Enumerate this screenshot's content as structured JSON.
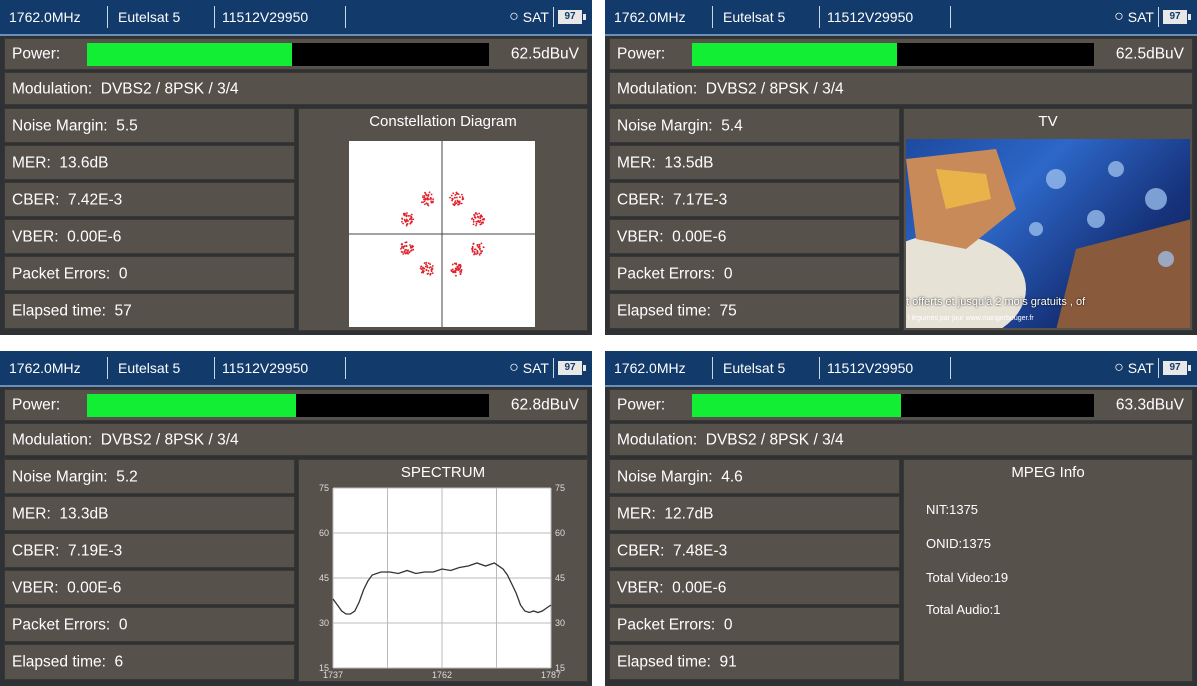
{
  "header": {
    "frequency": "1762.0MHz",
    "satellite": "Eutelsat 5",
    "transponder": "11512V29950",
    "mode": "SAT",
    "battery": "97",
    "dish_icon": "satellite-dish-icon"
  },
  "labels": {
    "power": "Power:",
    "modulation": "Modulation:",
    "noise_margin": "Noise Margin:",
    "mer": "MER:",
    "cber": "CBER:",
    "vber": "VBER:",
    "packet_errors": "Packet Errors:",
    "elapsed_time": "Elapsed time:"
  },
  "colors": {
    "header_bg": "#123a6a",
    "power_fill": "#11ee33",
    "constellation_points": "#e0202a",
    "spectrum_line": "#333333"
  },
  "screens": [
    {
      "power": "62.5dBuV",
      "power_level": 0.51,
      "modulation": "DVBS2 / 8PSK / 3/4",
      "noise_margin": "5.5",
      "mer": "13.6dB",
      "cber": "7.42E-3",
      "vber": "0.00E-6",
      "packet_errors": "0",
      "elapsed_time": "57",
      "panel_title": "Constellation Diagram",
      "panel_type": "constellation"
    },
    {
      "power": "62.5dBuV",
      "power_level": 0.51,
      "modulation": "DVBS2 / 8PSK / 3/4",
      "noise_margin": "5.4",
      "mer": "13.5dB",
      "cber": "7.17E-3",
      "vber": "0.00E-6",
      "packet_errors": "0",
      "elapsed_time": "75",
      "panel_title": "TV",
      "panel_type": "tv",
      "tv_caption": "t offerts et jusqu'à 2 mois gratuits , of",
      "tv_subcaption": "l légumes par jour www.mangerbouger.fr"
    },
    {
      "power": "62.8dBuV",
      "power_level": 0.52,
      "modulation": "DVBS2 / 8PSK / 3/4",
      "noise_margin": "5.2",
      "mer": "13.3dB",
      "cber": "7.19E-3",
      "vber": "0.00E-6",
      "packet_errors": "0",
      "elapsed_time": "6",
      "panel_title": "SPECTRUM",
      "panel_type": "spectrum"
    },
    {
      "power": "63.3dBuV",
      "power_level": 0.52,
      "modulation": "DVBS2 / 8PSK / 3/4",
      "noise_margin": "4.6",
      "mer": "12.7dB",
      "cber": "7.48E-3",
      "vber": "0.00E-6",
      "packet_errors": "0",
      "elapsed_time": "91",
      "panel_title": "MPEG Info",
      "panel_type": "mpeg",
      "mpeg": {
        "nit": "NIT:1375",
        "onid": "ONID:1375",
        "total_video": "Total Video:19",
        "total_audio": "Total Audio:1"
      }
    }
  ],
  "chart_data": {
    "type": "line",
    "title": "SPECTRUM",
    "x_ticks": [
      "1737",
      "1762",
      "1787"
    ],
    "xlim": [
      1737,
      1787
    ],
    "y_ticks_left": [
      "75",
      "60",
      "45",
      "30",
      "15"
    ],
    "y_ticks_right": [
      "75",
      "60",
      "45",
      "30",
      "15"
    ],
    "ylim": [
      15,
      75
    ],
    "grid": true,
    "x": [
      1737,
      1738,
      1739,
      1740,
      1741,
      1742,
      1743,
      1744,
      1745,
      1746,
      1748,
      1750,
      1752,
      1754,
      1756,
      1758,
      1760,
      1762,
      1764,
      1766,
      1768,
      1770,
      1772,
      1774,
      1776,
      1777,
      1778,
      1779,
      1780,
      1781,
      1782,
      1783,
      1784,
      1785,
      1786,
      1787
    ],
    "y": [
      38,
      36,
      34,
      33,
      33,
      34,
      37,
      41,
      44,
      46,
      47,
      47,
      46.5,
      47.5,
      46.5,
      47,
      47,
      48,
      47.5,
      48.5,
      49,
      50,
      49,
      50,
      48,
      46,
      43,
      40,
      36,
      34,
      33.5,
      34,
      33.5,
      34,
      35,
      36
    ]
  }
}
